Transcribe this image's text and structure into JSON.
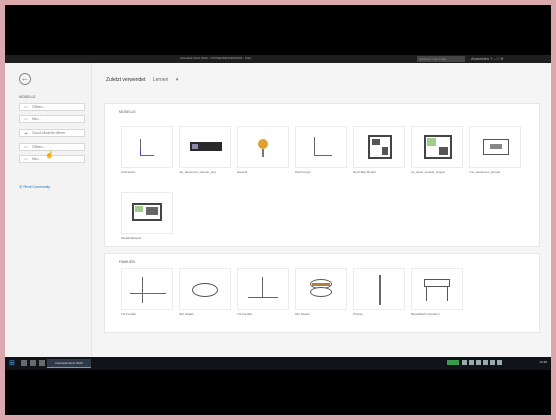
{
  "window": {
    "title": "Autodesk Revit 2020 - STUDENTENVERSION - Start",
    "search_placeholder": "Stichwort oder Frage",
    "user": "Anmelden",
    "controls": [
      "?",
      "–",
      "□",
      "✕"
    ]
  },
  "sidebar": {
    "section_label": "MODELLE",
    "items": [
      {
        "icon": "open-icon",
        "glyph": "▭",
        "label": "Öffnen..."
      },
      {
        "icon": "new-icon",
        "glyph": "▭",
        "label": "Neu..."
      },
      {
        "icon": "cloud-icon",
        "glyph": "☁",
        "label": "Cloud-Modelle öffnen"
      },
      {
        "icon": "open-icon",
        "glyph": "▭",
        "label": "Öffnen..."
      },
      {
        "icon": "new-icon",
        "glyph": "▭",
        "label": "Neu..."
      }
    ],
    "link": "Revit Community"
  },
  "main": {
    "title": "Zuletzt verwendet",
    "subtitle": "Lernen",
    "modelle": {
      "header": "MODELLE",
      "tiles": [
        {
          "label": "Architektur"
        },
        {
          "label": "rac_advanced_sample_proj"
        },
        {
          "label": "Haustür"
        },
        {
          "label": "Zeichnung1"
        },
        {
          "label": "Revit Bsp Modell"
        },
        {
          "label": "rst_basic_sample_project"
        },
        {
          "label": "rme_advanced_sample"
        },
        {
          "label": "Modell Beispiel"
        },
        {
          "label": "Projekt Beispiel"
        }
      ]
    },
    "familien": {
      "header": "FAMILIEN",
      "tiles": [
        {
          "label": "Tür Familie"
        },
        {
          "label": "Sitz Objekt"
        },
        {
          "label": "Tür Familie"
        },
        {
          "label": "Sitz Objekt"
        },
        {
          "label": "Pfosten"
        },
        {
          "label": "Beistelltisch Familie 1"
        }
      ]
    }
  },
  "taskbar": {
    "active_app": "Autodesk Revit 2020",
    "clock": "12:38"
  }
}
